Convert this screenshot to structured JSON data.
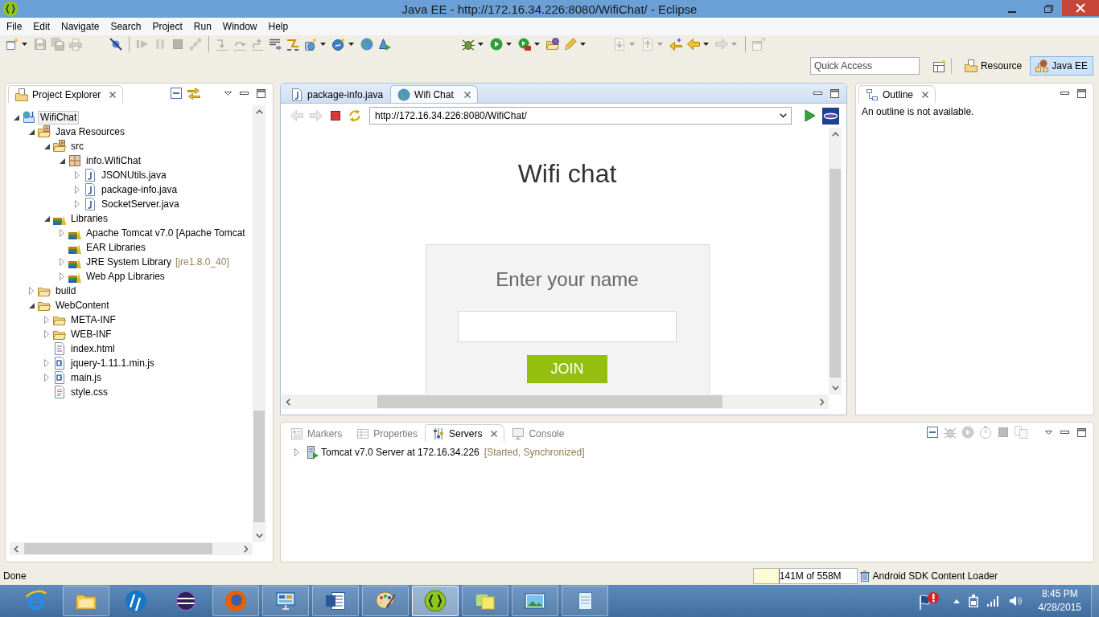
{
  "window": {
    "title": "Java EE - http://172.16.34.226:8080/WifiChat/ - Eclipse"
  },
  "menu_bar": [
    "File",
    "Edit",
    "Navigate",
    "Search",
    "Project",
    "Run",
    "Window",
    "Help"
  ],
  "toolbar": [
    {
      "disabled": false
    },
    {
      "disabled": true
    },
    {
      "disabled": true
    },
    {
      "disabled": true
    },
    {
      "disabled": false
    },
    {
      "disabled": true
    },
    {
      "disabled": true
    },
    {
      "disabled": true
    },
    {
      "disabled": true
    },
    {
      "disabled": true
    },
    {
      "disabled": true
    },
    {
      "disabled": true
    },
    {
      "disabled": false
    },
    {
      "disabled": false
    },
    {
      "disabled": false
    },
    {
      "disabled": false
    },
    {
      "disabled": false
    },
    {
      "disabled": false
    },
    {
      "disabled": false
    },
    {
      "disabled": false
    },
    {
      "disabled": false
    },
    {
      "disabled": false
    },
    {
      "disabled": false
    },
    {
      "disabled": true
    },
    {
      "disabled": true
    },
    {
      "disabled": false
    },
    {
      "disabled": false
    },
    {
      "disabled": true
    },
    {
      "disabled": true
    }
  ],
  "quick_access": {
    "placeholder": "Quick Access"
  },
  "perspectives": [
    {
      "label": "Resource",
      "kind": "resource",
      "selected": false
    },
    {
      "label": "Java EE",
      "kind": "java-ee",
      "selected": true
    }
  ],
  "project_explorer": {
    "title": "Project Explorer",
    "tree": [
      {
        "label": "WifiChat",
        "kind": "project",
        "expandable": true,
        "expanded": true,
        "selected": true,
        "children": [
          {
            "label": "Java Resources",
            "kind": "java-resources",
            "expandable": true,
            "expanded": true,
            "selected": false,
            "children": [
              {
                "label": "src",
                "kind": "source-folder",
                "expandable": true,
                "expanded": true,
                "selected": false,
                "children": [
                  {
                    "label": "info.WifiChat",
                    "kind": "package",
                    "expandable": true,
                    "expanded": true,
                    "selected": false,
                    "children": [
                      {
                        "label": "JSONUtils.java",
                        "kind": "java-file",
                        "expandable": true,
                        "expanded": false,
                        "selected": false
                      },
                      {
                        "label": "package-info.java",
                        "kind": "java-file",
                        "expandable": true,
                        "expanded": false,
                        "selected": false
                      },
                      {
                        "label": "SocketServer.java",
                        "kind": "java-file",
                        "expandable": true,
                        "expanded": false,
                        "selected": false
                      }
                    ]
                  }
                ]
              },
              {
                "label": "Libraries",
                "kind": "libraries",
                "expandable": true,
                "expanded": true,
                "selected": false,
                "children": [
                  {
                    "label": "Apache Tomcat v7.0 [Apache Tomcat",
                    "kind": "library",
                    "expandable": true,
                    "expanded": false,
                    "selected": false
                  },
                  {
                    "label": "EAR Libraries",
                    "kind": "library",
                    "expandable": false,
                    "selected": false
                  },
                  {
                    "label": "JRE System Library",
                    "decoration": "[jre1.8.0_40]",
                    "kind": "library",
                    "expandable": true,
                    "expanded": false,
                    "selected": false
                  },
                  {
                    "label": "Web App Libraries",
                    "kind": "library",
                    "expandable": true,
                    "expanded": false,
                    "selected": false
                  }
                ]
              }
            ]
          },
          {
            "label": "build",
            "kind": "folder",
            "expandable": true,
            "expanded": false,
            "selected": false
          },
          {
            "label": "WebContent",
            "kind": "folder",
            "expandable": true,
            "expanded": true,
            "selected": false,
            "children": [
              {
                "label": "META-INF",
                "kind": "folder",
                "expandable": true,
                "expanded": false,
                "selected": false
              },
              {
                "label": "WEB-INF",
                "kind": "folder",
                "expandable": true,
                "expanded": false,
                "selected": false
              },
              {
                "label": "index.html",
                "kind": "html-file",
                "expandable": false,
                "selected": false
              },
              {
                "label": "jquery-1.11.1.min.js",
                "kind": "js-file",
                "expandable": true,
                "expanded": false,
                "selected": false
              },
              {
                "label": "main.js",
                "kind": "js-file",
                "expandable": true,
                "expanded": false,
                "selected": false
              },
              {
                "label": "style.css",
                "kind": "css-file",
                "expandable": false,
                "selected": false
              }
            ]
          }
        ]
      }
    ]
  },
  "editor": {
    "tabs": [
      {
        "label": "package-info.java",
        "kind": "java-file",
        "selected": false
      },
      {
        "label": "Wifi Chat",
        "kind": "browser",
        "selected": true
      }
    ],
    "browser": {
      "buttons": [
        {
          "disabled": true
        },
        {
          "disabled": true
        },
        {
          "disabled": false
        },
        {
          "disabled": false
        }
      ],
      "url": "http://172.16.34.226:8080/WifiChat/",
      "page": {
        "heading": "Wifi chat",
        "form_title": "Enter your name",
        "join_button": "JOIN"
      }
    }
  },
  "outline": {
    "title": "Outline",
    "message": "An outline is not available."
  },
  "bottom_panel": {
    "tabs": [
      {
        "label": "Markers",
        "kind": "markers",
        "selected": false
      },
      {
        "label": "Properties",
        "kind": "properties",
        "selected": false
      },
      {
        "label": "Servers",
        "kind": "servers",
        "selected": true
      },
      {
        "label": "Console",
        "kind": "console",
        "selected": false
      }
    ],
    "actions": [
      {
        "disabled": false
      },
      {
        "disabled": true
      },
      {
        "disabled": true
      },
      {
        "disabled": true
      },
      {
        "disabled": true
      },
      {
        "disabled": true
      }
    ],
    "servers": [
      {
        "name": "Tomcat v7.0 Server at 172.16.34.226",
        "status": "[Started, Synchronized]",
        "expandable": true,
        "expanded": false
      }
    ]
  },
  "status_bar": {
    "message": "Done",
    "memory": {
      "text": "141M of 558M",
      "level": 0.25
    },
    "job": "Android SDK Content Loader"
  },
  "taskbar": {
    "apps": [
      {
        "running": false,
        "selected": false
      },
      {
        "running": true,
        "selected": false
      },
      {
        "running": false,
        "selected": false
      },
      {
        "running": false,
        "selected": false
      },
      {
        "running": true,
        "selected": false
      },
      {
        "running": true,
        "selected": false
      },
      {
        "running": true,
        "selected": false
      },
      {
        "running": true,
        "selected": false
      },
      {
        "running": true,
        "selected": true
      },
      {
        "running": true,
        "selected": false
      },
      {
        "running": true,
        "selected": false
      },
      {
        "running": true,
        "selected": false
      }
    ],
    "clock": {
      "time": "8:45 PM",
      "date": "4/28/2015"
    }
  }
}
